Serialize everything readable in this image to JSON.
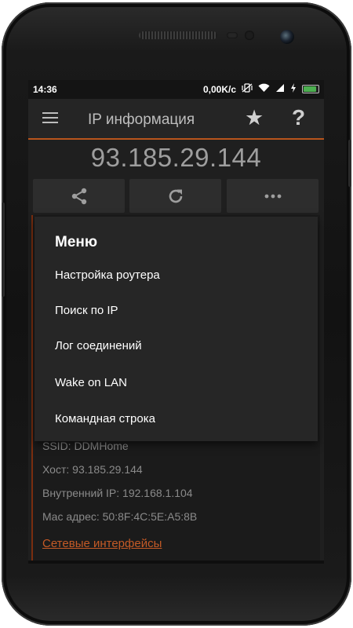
{
  "status_bar": {
    "time": "14:36",
    "network_speed": "0,00K/c",
    "battery_level": 0.9,
    "icons": [
      "vibrate-off-icon",
      "wifi-icon",
      "signal-icon",
      "charging-icon",
      "battery-icon"
    ]
  },
  "app_bar": {
    "title": "IP информация",
    "icons": [
      "hamburger-menu-icon",
      "star-icon",
      "help-icon"
    ]
  },
  "ip_address": "93.185.29.144",
  "actions": [
    "share-icon",
    "refresh-icon",
    "more-icon"
  ],
  "menu": {
    "title": "Меню",
    "items": [
      "Настройка роутера",
      "Поиск по IP",
      "Лог соединений",
      "Wake on LAN",
      "Командная строка"
    ]
  },
  "info": {
    "ssid": "SSID: DDMHome",
    "host": "Хост: 93.185.29.144",
    "internal_ip": "Внутренний IP: 192.168.1.104",
    "mac": "Mac адрес: 50:8F:4C:5E:A5:8B",
    "interfaces_link": "Сетевые интерфейсы"
  },
  "colors": {
    "accent": "#b8541c",
    "link": "#c45a26",
    "battery": "#4caf50"
  }
}
